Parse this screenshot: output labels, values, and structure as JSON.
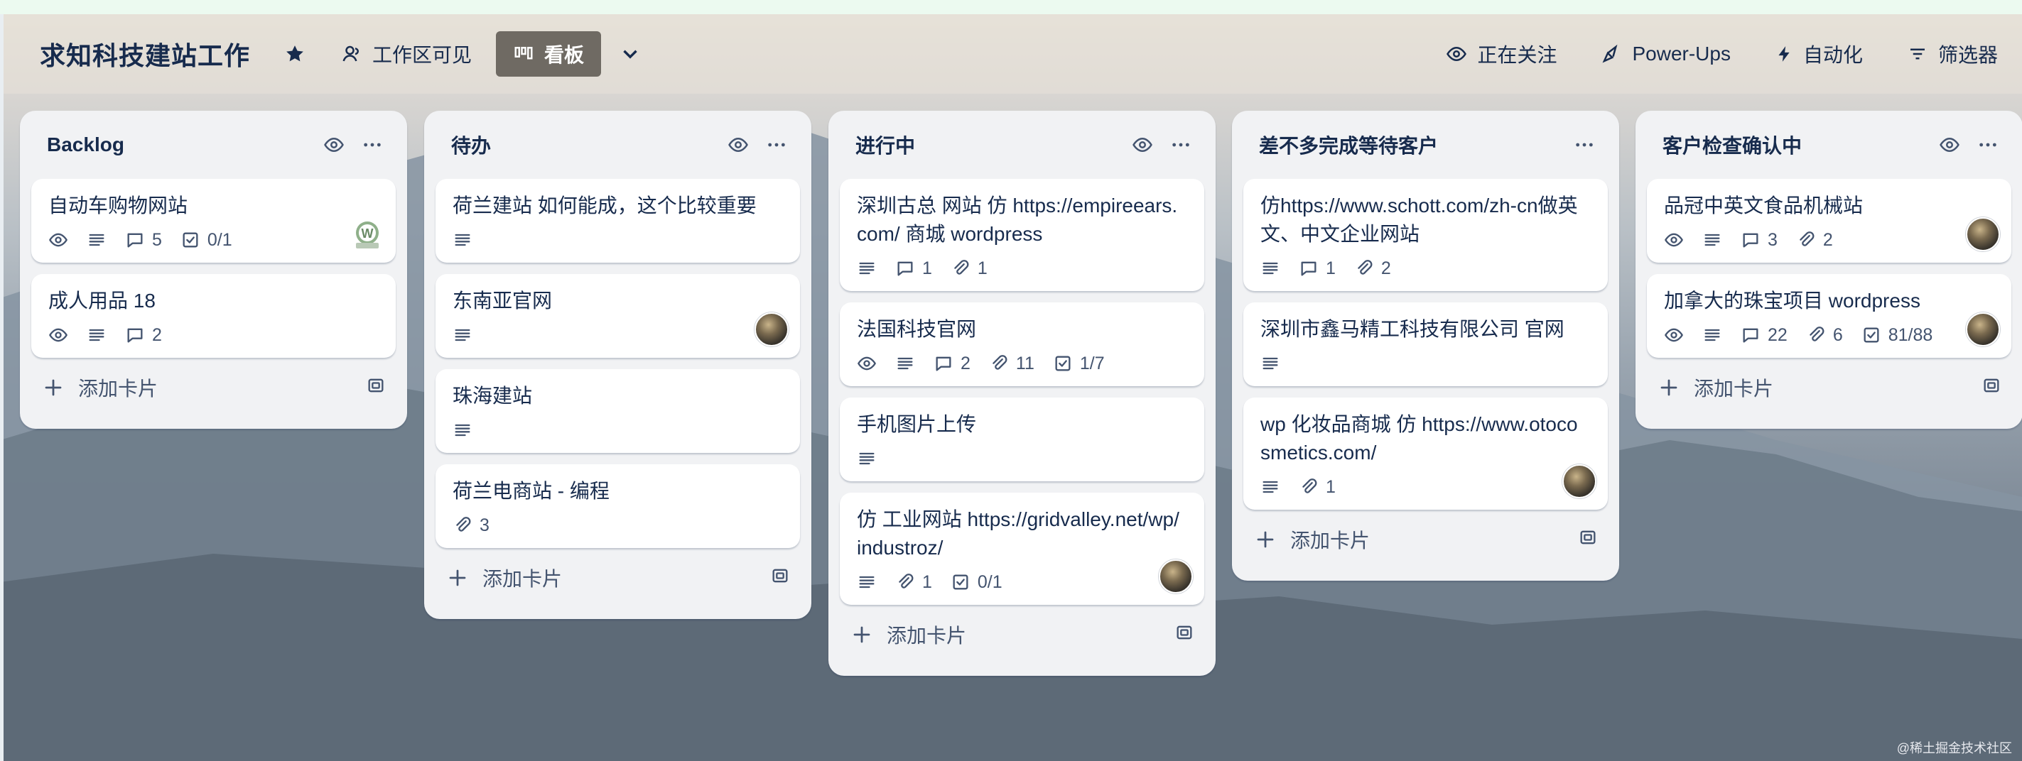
{
  "header": {
    "board_title": "求知科技建站工作",
    "visibility_label": "工作区可见",
    "view_label": "看板",
    "watch_label": "正在关注",
    "powerups_label": "Power-Ups",
    "automation_label": "自动化",
    "filter_label": "筛选器"
  },
  "colors": {
    "list_bg": "#f1f2f4",
    "card_bg": "#ffffff",
    "text": "#172b4d",
    "muted": "#44546f",
    "view_button": "#6f6a63"
  },
  "add_card_label": "添加卡片",
  "lists": [
    {
      "title": "Backlog",
      "watched": true,
      "cards": [
        {
          "title": "自动车购物网站",
          "watch": true,
          "desc": true,
          "comments": "5",
          "attachments": null,
          "checklist": "0/1",
          "avatar": "wp-logo"
        },
        {
          "title": "成人用品 18",
          "watch": true,
          "desc": true,
          "comments": "2",
          "attachments": null,
          "checklist": null,
          "avatar": null
        }
      ]
    },
    {
      "title": "待办",
      "watched": true,
      "cards": [
        {
          "title": "荷兰建站 如何能成，这个比较重要",
          "watch": false,
          "desc": true,
          "comments": null,
          "attachments": null,
          "checklist": null,
          "avatar": null
        },
        {
          "title": "东南亚官网",
          "watch": false,
          "desc": true,
          "comments": null,
          "attachments": null,
          "checklist": null,
          "avatar": "photo"
        },
        {
          "title": "珠海建站",
          "watch": false,
          "desc": true,
          "comments": null,
          "attachments": null,
          "checklist": null,
          "avatar": null
        },
        {
          "title": "荷兰电商站 - 编程",
          "watch": false,
          "desc": false,
          "comments": null,
          "attachments": "3",
          "checklist": null,
          "avatar": null
        }
      ]
    },
    {
      "title": "进行中",
      "watched": true,
      "cards": [
        {
          "title": "深圳古总 网站 仿 https://empireears.com/ 商城 wordpress",
          "watch": false,
          "desc": true,
          "comments": "1",
          "attachments": "1",
          "checklist": null,
          "avatar": null
        },
        {
          "title": "法国科技官网",
          "watch": true,
          "desc": true,
          "comments": "2",
          "attachments": "11",
          "checklist": "1/7",
          "avatar": null
        },
        {
          "title": "手机图片上传",
          "watch": false,
          "desc": true,
          "comments": null,
          "attachments": null,
          "checklist": null,
          "avatar": null
        },
        {
          "title": "仿 工业网站 https://gridvalley.net/wp/industroz/",
          "watch": false,
          "desc": true,
          "comments": null,
          "attachments": "1",
          "checklist": "0/1",
          "avatar": "photo"
        }
      ]
    },
    {
      "title": "差不多完成等待客户",
      "watched": false,
      "cards": [
        {
          "title": "仿https://www.schott.com/zh-cn做英文、中文企业网站",
          "watch": false,
          "desc": true,
          "comments": "1",
          "attachments": "2",
          "checklist": null,
          "avatar": null
        },
        {
          "title": "深圳市鑫马精工科技有限公司 官网",
          "watch": false,
          "desc": true,
          "comments": null,
          "attachments": null,
          "checklist": null,
          "avatar": null
        },
        {
          "title": "wp 化妆品商城 仿 https://www.otocosmetics.com/",
          "watch": false,
          "desc": true,
          "comments": null,
          "attachments": "1",
          "checklist": null,
          "avatar": "photo"
        }
      ]
    },
    {
      "title": "客户检查确认中",
      "watched": true,
      "cards": [
        {
          "title": "品冠中英文食品机械站",
          "watch": true,
          "desc": true,
          "comments": "3",
          "attachments": "2",
          "checklist": null,
          "avatar": "photo"
        },
        {
          "title": "加拿大的珠宝项目 wordpress",
          "watch": true,
          "desc": true,
          "comments": "22",
          "attachments": "6",
          "checklist": "81/88",
          "avatar": "photo"
        }
      ]
    }
  ],
  "watermark": "@稀土掘金技术社区"
}
